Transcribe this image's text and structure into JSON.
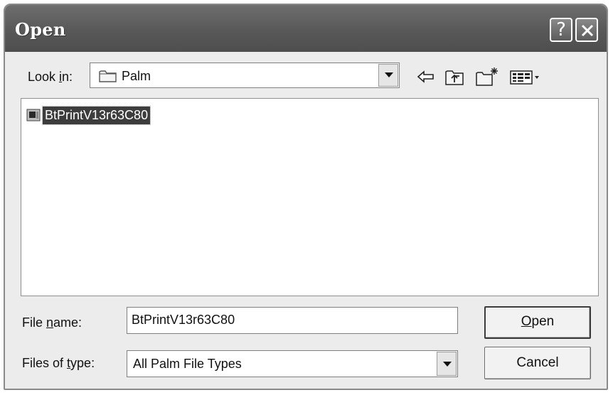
{
  "window": {
    "title": "Open",
    "help_icon": "question-mark-icon",
    "close_icon": "close-icon"
  },
  "lookin": {
    "label_pre": "Look ",
    "label_ul": "i",
    "label_post": "n:",
    "value": "Palm",
    "icon": "folder-icon"
  },
  "toolbar": {
    "back_icon": "back-arrow-icon",
    "up_icon": "up-one-level-icon",
    "new_folder_icon": "new-folder-icon",
    "views_icon": "views-menu-icon"
  },
  "files": [
    {
      "name": "BtPrintV13r63C80",
      "icon": "program-file-icon",
      "selected": true
    }
  ],
  "filename": {
    "label_pre": "File ",
    "label_ul": "n",
    "label_post": "ame:",
    "value": "BtPrintV13r63C80"
  },
  "filetype": {
    "label_pre": "Files of ",
    "label_ul": "t",
    "label_post": "ype:",
    "value": "All Palm File Types"
  },
  "buttons": {
    "open_ul": "O",
    "open_rest": "pen",
    "cancel": "Cancel"
  }
}
